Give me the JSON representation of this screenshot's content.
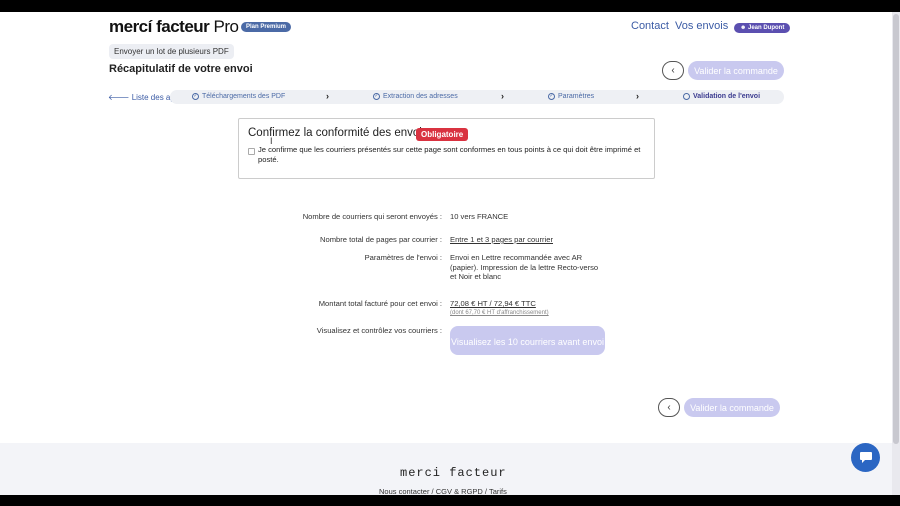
{
  "header": {
    "logo_main": "mercí facteur",
    "logo_pro": "Pro",
    "plan_badge": "Plan Premium",
    "nav_contact": "Contact",
    "nav_envois": "Vos envois",
    "user_badge": "☻ Jean Dupont"
  },
  "toolbar": {
    "lot_button": "Envoyer un lot de plusieurs PDF",
    "page_title": "Récapitulatif de votre envoi",
    "back_icon": "‹",
    "valider_label": "Valider la commande"
  },
  "steps": {
    "apps_link": "Liste des apps",
    "items": [
      {
        "label": "Téléchargements des PDF"
      },
      {
        "label": "Extraction des adresses"
      },
      {
        "label": "Paramètres"
      },
      {
        "label": "Validation de l'envoi"
      }
    ]
  },
  "confirm": {
    "title": "Confirmez la conformité des envois",
    "badge": "Obligatoire",
    "text": "Je confirme que les courriers présentés sur cette page sont conformes en tous points à ce qui doit être imprimé et posté."
  },
  "summary": {
    "rows": [
      {
        "label": "Nombre de courriers qui seront envoyés :",
        "value": "10 vers FRANCE"
      },
      {
        "label": "Nombre total de pages par courrier :",
        "value": "Entre 1 et 3 pages par courrier"
      },
      {
        "label": "Paramètres de l'envoi :",
        "value": "Envoi en Lettre recommandée avec AR (papier). Impression de la lettre Recto-verso et Noir et blanc"
      },
      {
        "label": "Montant total facturé pour cet envoi :",
        "value": "72,08 € HT / 72,94 € TTC",
        "sub": "(dont 67,70 € HT d'affranchissement)"
      },
      {
        "label": "Visualisez et contrôlez vos courriers :"
      }
    ],
    "visualisez_button": "Visualisez les 10 courriers avant envoi"
  },
  "footer": {
    "logo": "merci facteur",
    "link_contact": "Nous contacter",
    "link_cgv": "CGV & RGPD",
    "link_tarifs": "Tarifs",
    "separator": "/"
  },
  "colors": {
    "accent": "#3b5ba5",
    "danger": "#d93240",
    "disabled_button": "#c9c9ef"
  }
}
